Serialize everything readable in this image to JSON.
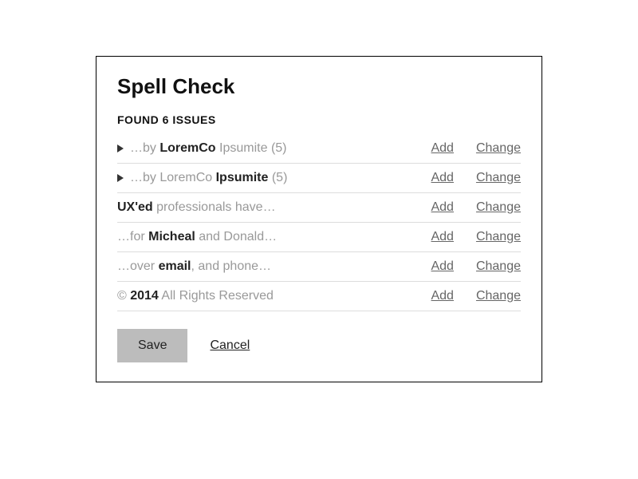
{
  "dialog": {
    "title": "Spell Check",
    "subtitle": "FOUND 6 ISSUES",
    "add_label": "Add",
    "change_label": "Change",
    "save_label": "Save",
    "cancel_label": "Cancel"
  },
  "issues": [
    {
      "pre": "…by ",
      "hl": "LoremCo",
      "post": " Ipsumite (5)",
      "expandable": true
    },
    {
      "pre": "…by LoremCo ",
      "hl": "Ipsumite",
      "post": " (5)",
      "expandable": true
    },
    {
      "pre": "",
      "hl": "UX'ed",
      "post": " professionals have…",
      "expandable": false
    },
    {
      "pre": "…for ",
      "hl": "Micheal",
      "post": " and Donald…",
      "expandable": false
    },
    {
      "pre": "…over ",
      "hl": "email",
      "post": ", and phone…",
      "expandable": false
    },
    {
      "pre": "© ",
      "hl": "2014",
      "post": " All Rights Reserved",
      "expandable": false
    }
  ]
}
